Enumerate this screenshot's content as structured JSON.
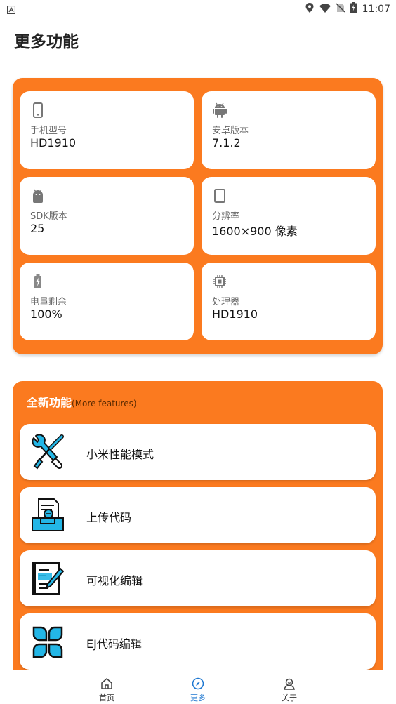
{
  "status_bar": {
    "time": "11:07"
  },
  "page": {
    "title": "更多功能"
  },
  "device_info": [
    {
      "icon": "phone-icon",
      "label": "手机型号",
      "value": "HD1910"
    },
    {
      "icon": "android-icon",
      "label": "安卓版本",
      "value": "7.1.2"
    },
    {
      "icon": "android-head-icon",
      "label": "SDK版本",
      "value": "25"
    },
    {
      "icon": "screen-icon",
      "label": "分辨率",
      "value": "1600×900 像素"
    },
    {
      "icon": "battery-icon",
      "label": "电量剩余",
      "value": "100%"
    },
    {
      "icon": "chip-icon",
      "label": "处理器",
      "value": "HD1910"
    }
  ],
  "features": {
    "heading": "全新功能",
    "heading_sub": "(More features)",
    "items": [
      {
        "icon": "tools-icon",
        "label": "小米性能模式"
      },
      {
        "icon": "upload-code-icon",
        "label": "上传代码"
      },
      {
        "icon": "visual-edit-icon",
        "label": "可视化编辑"
      },
      {
        "icon": "grid-icon",
        "label": "EJ代码编辑"
      }
    ]
  },
  "bottom_nav": [
    {
      "icon": "home-icon",
      "label": "首页",
      "active": false
    },
    {
      "icon": "compass-icon",
      "label": "更多",
      "active": true
    },
    {
      "icon": "person-icon",
      "label": "关于",
      "active": false
    }
  ],
  "colors": {
    "accent": "#fb7a1f",
    "active_nav": "#1f78d1",
    "icon_blue": "#23b6e6"
  }
}
